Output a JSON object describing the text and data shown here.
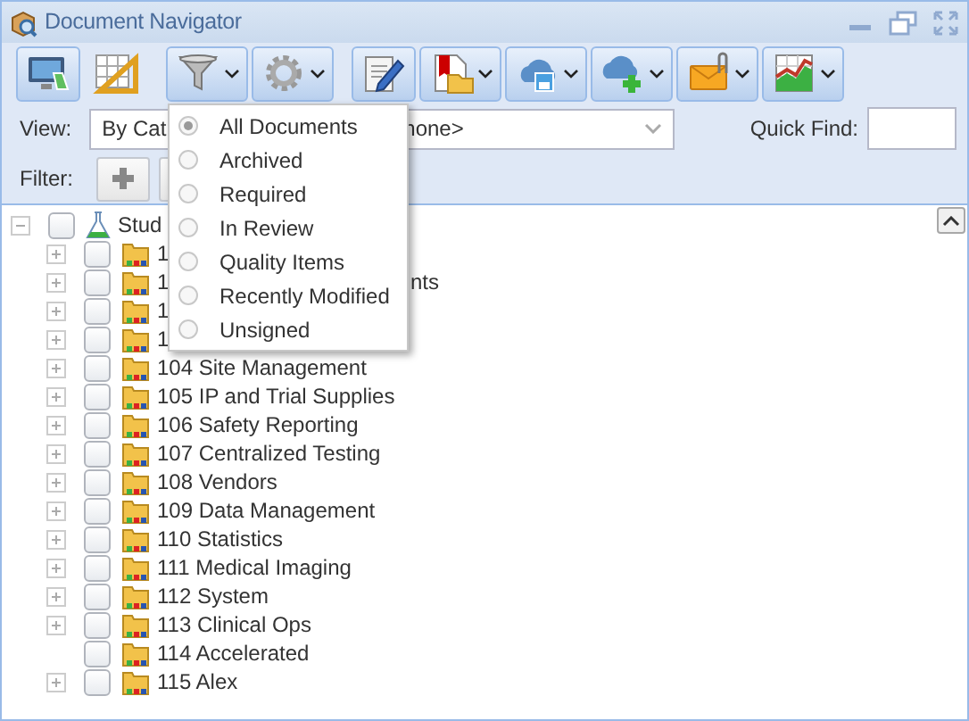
{
  "window": {
    "title": "Document Navigator"
  },
  "toolbar": [
    {
      "kind": "monitor",
      "menu": false,
      "framed": true
    },
    {
      "kind": "grid",
      "menu": false,
      "framed": false
    },
    {
      "kind": "funnel",
      "menu": true,
      "framed": true
    },
    {
      "kind": "gear",
      "menu": true,
      "framed": true
    },
    {
      "kind": "edit",
      "menu": false,
      "framed": true
    },
    {
      "kind": "pdf",
      "menu": true,
      "framed": true
    },
    {
      "kind": "cloudsave",
      "menu": true,
      "framed": true
    },
    {
      "kind": "cloudadd",
      "menu": true,
      "framed": true
    },
    {
      "kind": "mail",
      "menu": true,
      "framed": true
    },
    {
      "kind": "chart",
      "menu": true,
      "framed": true
    }
  ],
  "view": {
    "label": "View:",
    "value": "By Cat",
    "value_2": "none>",
    "quick_find_label": "Quick Find:"
  },
  "filter": {
    "label": "Filter:"
  },
  "menu": [
    {
      "label": "All Documents",
      "selected": true
    },
    {
      "label": "Archived",
      "selected": false
    },
    {
      "label": "Required",
      "selected": false
    },
    {
      "label": "In Review",
      "selected": false
    },
    {
      "label": "Quality Items",
      "selected": false
    },
    {
      "label": "Recently Modified",
      "selected": false
    },
    {
      "label": "Unsigned",
      "selected": false
    }
  ],
  "tree": {
    "label": "Stud",
    "checked": false,
    "expanded": true,
    "children": [
      {
        "label": "1",
        "checked": false,
        "expandable": true
      },
      {
        "label": "1",
        "tail": "nts",
        "checked": false,
        "expandable": true
      },
      {
        "label": "1",
        "checked": false,
        "expandable": true
      },
      {
        "label": "1",
        "checked": false,
        "expandable": true
      },
      {
        "label": "104 Site Management",
        "checked": false,
        "expandable": true
      },
      {
        "label": "105 IP and Trial Supplies",
        "checked": false,
        "expandable": true
      },
      {
        "label": "106 Safety Reporting",
        "checked": false,
        "expandable": true
      },
      {
        "label": "107 Centralized Testing",
        "checked": false,
        "expandable": true
      },
      {
        "label": "108 Vendors",
        "checked": false,
        "expandable": true
      },
      {
        "label": "109 Data Management",
        "checked": false,
        "expandable": true
      },
      {
        "label": "110 Statistics",
        "checked": false,
        "expandable": true
      },
      {
        "label": "111 Medical Imaging",
        "checked": false,
        "expandable": true
      },
      {
        "label": "112 System",
        "checked": false,
        "expandable": true
      },
      {
        "label": "113 Clinical Ops",
        "checked": false,
        "expandable": true
      },
      {
        "label": "114 Accelerated",
        "checked": false,
        "expandable": false
      },
      {
        "label": "115 Alex",
        "checked": false,
        "expandable": true
      }
    ]
  }
}
